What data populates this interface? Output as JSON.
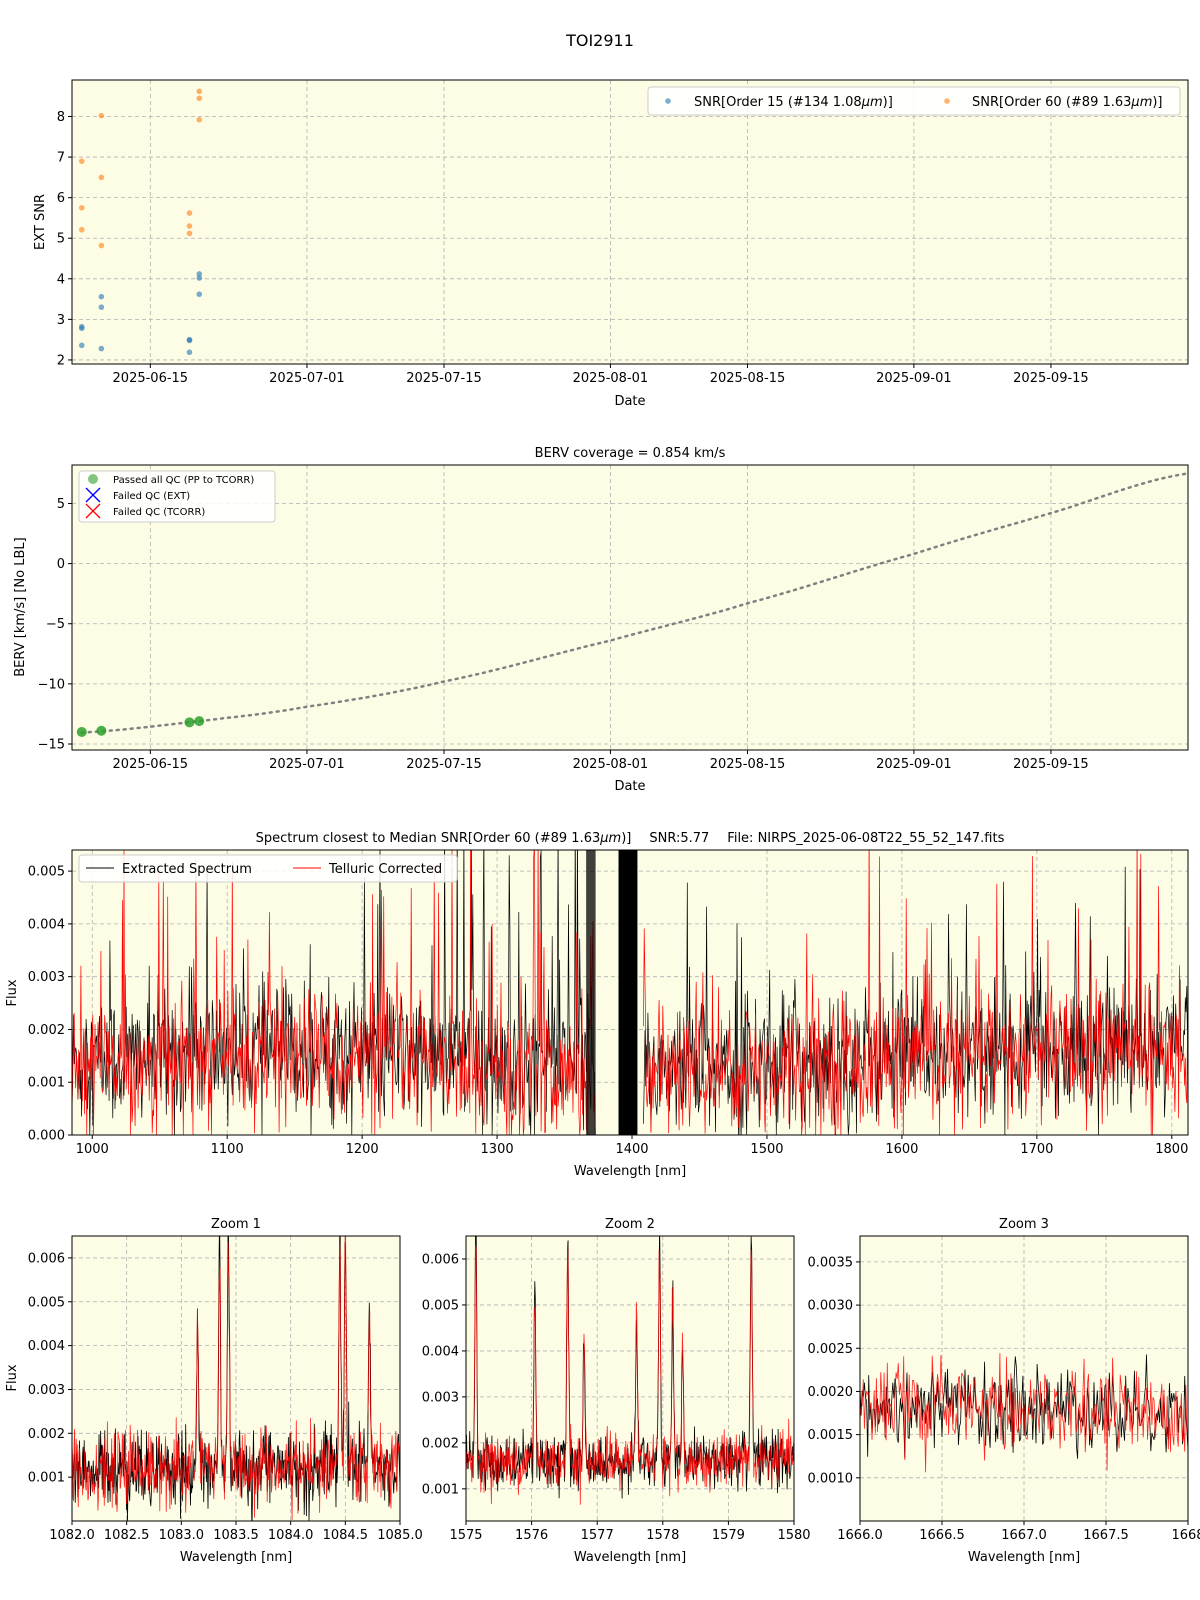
{
  "figure_title": "TOI2911",
  "colors": {
    "background": "#fdfde6",
    "order15": "#1f77b4",
    "order60": "#ff7f0e",
    "extracted": "#000000",
    "telluric": "#ff0000",
    "passed": "#2ca02c",
    "failed_ext": "#0000ff",
    "failed_tcorr": "#ff0000",
    "berv_curve": "#808080"
  },
  "chart_data": [
    {
      "type": "scatter",
      "xlabel": "Date",
      "ylabel": "EXT SNR",
      "xlim": [
        "2025-06-07",
        "2025-09-29"
      ],
      "ylim": [
        1.9,
        8.9
      ],
      "x_ticks": [
        "2025-06-15",
        "2025-07-01",
        "2025-07-15",
        "2025-08-01",
        "2025-08-15",
        "2025-09-01",
        "2025-09-15"
      ],
      "y_ticks": [
        2,
        3,
        4,
        5,
        6,
        7,
        8
      ],
      "grid": true,
      "legend_position": "top-right",
      "series": [
        {
          "name": "SNR[Order 15 (#134 1.08μm)]",
          "label_prefix": "SNR[Order 15 (#134 1.08",
          "label_unit": "μm",
          "label_suffix": ")]",
          "points": [
            {
              "x": "2025-06-08",
              "y": 2.82
            },
            {
              "x": "2025-06-08",
              "y": 2.78
            },
            {
              "x": "2025-06-08",
              "y": 2.36
            },
            {
              "x": "2025-06-10",
              "y": 3.56
            },
            {
              "x": "2025-06-10",
              "y": 3.3
            },
            {
              "x": "2025-06-10",
              "y": 2.28
            },
            {
              "x": "2025-06-19",
              "y": 2.5
            },
            {
              "x": "2025-06-19",
              "y": 2.48
            },
            {
              "x": "2025-06-19",
              "y": 2.19
            },
            {
              "x": "2025-06-20",
              "y": 4.12
            },
            {
              "x": "2025-06-20",
              "y": 4.02
            },
            {
              "x": "2025-06-20",
              "y": 3.62
            }
          ]
        },
        {
          "name": "SNR[Order 60 (#89 1.63μm)]",
          "label_prefix": "SNR[Order 60 (#89 1.63",
          "label_unit": "μm",
          "label_suffix": ")]",
          "points": [
            {
              "x": "2025-06-08",
              "y": 6.9
            },
            {
              "x": "2025-06-08",
              "y": 5.75
            },
            {
              "x": "2025-06-08",
              "y": 5.21
            },
            {
              "x": "2025-06-10",
              "y": 8.02
            },
            {
              "x": "2025-06-10",
              "y": 6.5
            },
            {
              "x": "2025-06-10",
              "y": 4.82
            },
            {
              "x": "2025-06-19",
              "y": 5.62
            },
            {
              "x": "2025-06-19",
              "y": 5.3
            },
            {
              "x": "2025-06-19",
              "y": 5.12
            },
            {
              "x": "2025-06-20",
              "y": 8.62
            },
            {
              "x": "2025-06-20",
              "y": 8.45
            },
            {
              "x": "2025-06-20",
              "y": 7.92
            }
          ]
        }
      ]
    },
    {
      "type": "scatter",
      "title": "BERV coverage = 0.854 km/s",
      "xlabel": "Date",
      "ylabel": "BERV [km/s]  [No LBL]",
      "xlim": [
        "2025-06-07",
        "2025-09-29"
      ],
      "ylim": [
        -15.5,
        8.2
      ],
      "x_ticks": [
        "2025-06-15",
        "2025-07-01",
        "2025-07-15",
        "2025-08-01",
        "2025-08-15",
        "2025-09-01",
        "2025-09-15"
      ],
      "y_ticks": [
        -15,
        -10,
        -5,
        0,
        5
      ],
      "grid": true,
      "legend_position": "top-left",
      "legend": [
        "Passed all QC (PP to TCORR)",
        "Failed QC (EXT)",
        "Failed QC (TCORR)"
      ],
      "passed_points": [
        {
          "x": "2025-06-08",
          "y": -14.0
        },
        {
          "x": "2025-06-10",
          "y": -13.9
        },
        {
          "x": "2025-06-19",
          "y": -13.2
        },
        {
          "x": "2025-06-20",
          "y": -13.1
        }
      ],
      "berv_curve": [
        {
          "x": "2025-06-08",
          "y": -14.05
        },
        {
          "x": "2025-06-20",
          "y": -13.1
        },
        {
          "x": "2025-07-01",
          "y": -11.9
        },
        {
          "x": "2025-07-15",
          "y": -9.8
        },
        {
          "x": "2025-08-01",
          "y": -6.4
        },
        {
          "x": "2025-08-15",
          "y": -3.3
        },
        {
          "x": "2025-09-01",
          "y": 0.8
        },
        {
          "x": "2025-09-15",
          "y": 4.2
        },
        {
          "x": "2025-09-29",
          "y": 7.5
        }
      ]
    },
    {
      "type": "line",
      "title_prefix": "Spectrum closest to Median SNR[Order 60 (#89 1.63",
      "title_unit": "μm",
      "title_suffix": ")]",
      "title_snr": "SNR:5.77",
      "title_file": "File: NIRPS_2025-06-08T22_55_52_147.fits",
      "xlabel": "Wavelength [nm]",
      "ylabel": "Flux",
      "xlim": [
        985,
        1812
      ],
      "ylim": [
        0,
        0.0054
      ],
      "x_ticks": [
        1000,
        1100,
        1200,
        1300,
        1400,
        1500,
        1600,
        1700,
        1800
      ],
      "y_ticks": [
        "0.000",
        "0.001",
        "0.002",
        "0.003",
        "0.004",
        "0.005"
      ],
      "grid": true,
      "legend_position": "top-left",
      "legend": [
        "Extracted Spectrum",
        "Telluric Corrected"
      ],
      "gaps_nm": [
        [
          1373,
          1390
        ],
        [
          1404,
          1408
        ]
      ],
      "black_bands_nm": [
        [
          1390,
          1404
        ]
      ]
    },
    {
      "type": "line",
      "title": "Zoom 1",
      "xlabel": "Wavelength [nm]",
      "ylabel": "Flux",
      "xlim": [
        1082.0,
        1085.0
      ],
      "ylim": [
        0.0,
        0.0065
      ],
      "x_ticks": [
        "1082.0",
        "1082.5",
        "1083.0",
        "1083.5",
        "1084.0",
        "1084.5",
        "1085.0"
      ],
      "y_ticks": [
        "0.001",
        "0.002",
        "0.003",
        "0.004",
        "0.005",
        "0.006"
      ],
      "grid": true,
      "baseline": 0.0012,
      "spikes": [
        {
          "x": 1083.15,
          "y": 0.0046
        },
        {
          "x": 1083.35,
          "y": 0.0065
        },
        {
          "x": 1083.43,
          "y": 0.0065
        },
        {
          "x": 1084.45,
          "y": 0.0065
        },
        {
          "x": 1084.5,
          "y": 0.0065
        },
        {
          "x": 1084.72,
          "y": 0.0048
        }
      ]
    },
    {
      "type": "line",
      "title": "Zoom 2",
      "xlabel": "Wavelength [nm]",
      "xlim": [
        1575,
        1580
      ],
      "ylim": [
        0.0003,
        0.0065
      ],
      "x_ticks": [
        "1575",
        "1576",
        "1577",
        "1578",
        "1579",
        "1580"
      ],
      "y_ticks": [
        "0.001",
        "0.002",
        "0.003",
        "0.004",
        "0.005",
        "0.006"
      ],
      "grid": true,
      "baseline": 0.0016,
      "spikes": [
        {
          "x": 1575.15,
          "y": 0.0065
        },
        {
          "x": 1576.05,
          "y": 0.0052
        },
        {
          "x": 1576.55,
          "y": 0.0065
        },
        {
          "x": 1576.8,
          "y": 0.0042
        },
        {
          "x": 1577.6,
          "y": 0.0047
        },
        {
          "x": 1577.95,
          "y": 0.0065
        },
        {
          "x": 1578.15,
          "y": 0.0051
        },
        {
          "x": 1578.3,
          "y": 0.0041
        },
        {
          "x": 1579.35,
          "y": 0.0065
        }
      ]
    },
    {
      "type": "line",
      "title": "Zoom 3",
      "xlabel": "Wavelength [nm]",
      "xlim": [
        1666.0,
        1668.0
      ],
      "ylim": [
        0.0005,
        0.0038
      ],
      "x_ticks": [
        "1666.0",
        "1666.5",
        "1667.0",
        "1667.5",
        "1668"
      ],
      "y_ticks": [
        "0.0010",
        "0.0015",
        "0.0020",
        "0.0025",
        "0.0030",
        "0.0035"
      ],
      "grid": true,
      "baseline": 0.0018
    }
  ]
}
